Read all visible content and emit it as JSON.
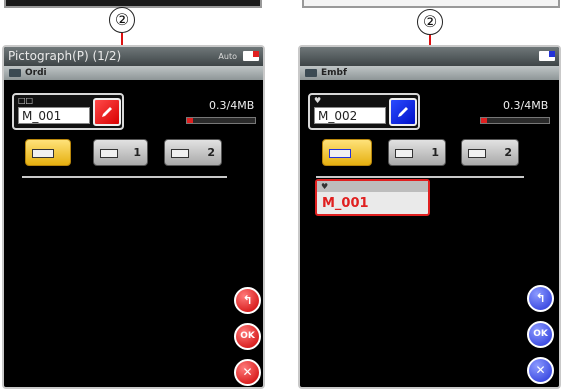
{
  "callouts": {
    "left": "②",
    "right": "②"
  },
  "left_screen": {
    "title": "Pictograph(P) (1/2)",
    "status_icons": "Auto",
    "path": "Ordi",
    "design_label": "□□",
    "design_name": "M_001",
    "memory": "0.3/4MB",
    "memory_fraction": 0.07,
    "destinations": [
      {
        "label": "",
        "selected": true
      },
      {
        "label": "1",
        "selected": false
      },
      {
        "label": "2",
        "selected": false
      }
    ],
    "buttons": {
      "back": "↰",
      "ok": "OK",
      "cancel": "✕"
    },
    "accent": "#e02020"
  },
  "right_screen": {
    "title": "",
    "path": "Embf",
    "design_label": "♥",
    "design_name": "M_002",
    "memory": "0.3/4MB",
    "memory_fraction": 0.07,
    "destinations": [
      {
        "label": "",
        "selected": true
      },
      {
        "label": "1",
        "selected": false
      },
      {
        "label": "2",
        "selected": false
      }
    ],
    "file": {
      "label": "♥",
      "name": "M_001"
    },
    "buttons": {
      "back": "↰",
      "ok": "OK",
      "cancel": "✕"
    },
    "accent": "#2433d8"
  }
}
